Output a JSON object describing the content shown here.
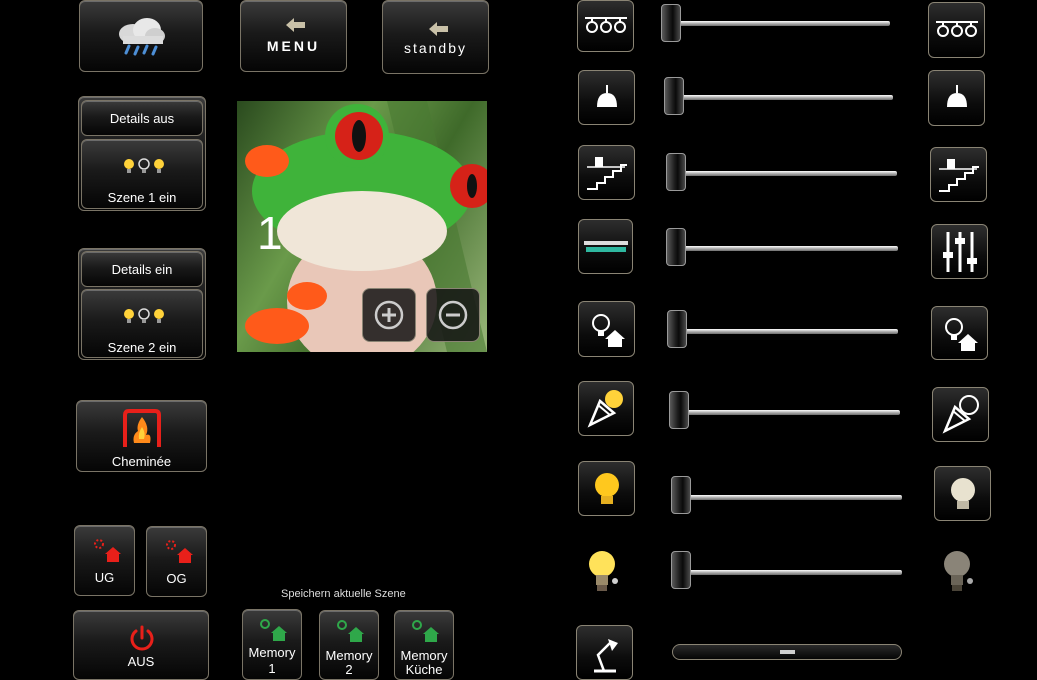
{
  "header": {
    "menu_label": "MENU",
    "standby_label": "standby"
  },
  "left": {
    "details_off": "Details aus",
    "scene1": "Szene 1 ein",
    "details_on": "Details ein",
    "scene2": "Szene 2 ein",
    "fireplace": "Cheminée",
    "ug": "UG",
    "og": "OG",
    "off": "AUS"
  },
  "viewer": {
    "number": "1"
  },
  "memory": {
    "caption": "Speichern aktuelle Szene",
    "m1_line1": "Memory",
    "m1_line2": "1",
    "m2_line1": "Memory",
    "m2_line2": "2",
    "m3_line1": "Memory",
    "m3_line2": "Küche"
  },
  "dimmers": [
    {
      "icon": "track-lights-icon",
      "level": 0
    },
    {
      "icon": "pendant-lamp-icon",
      "level": 0
    },
    {
      "icon": "staircase-light-icon",
      "level": 0
    },
    {
      "icon": "ceiling-panel-icon",
      "level": 0
    },
    {
      "icon": "house-bulb-icon",
      "level": 0
    },
    {
      "icon": "spotlight-icon",
      "level": 0
    },
    {
      "icon": "bulb-icon",
      "level": 0
    },
    {
      "icon": "lightbulb-icon",
      "level": 0
    },
    {
      "icon": "desk-lamp-icon",
      "level": 50
    }
  ],
  "colors": {
    "accent_red": "#e8201a",
    "accent_green": "#2fa84a",
    "lamp_yellow": "#ffd23a"
  }
}
